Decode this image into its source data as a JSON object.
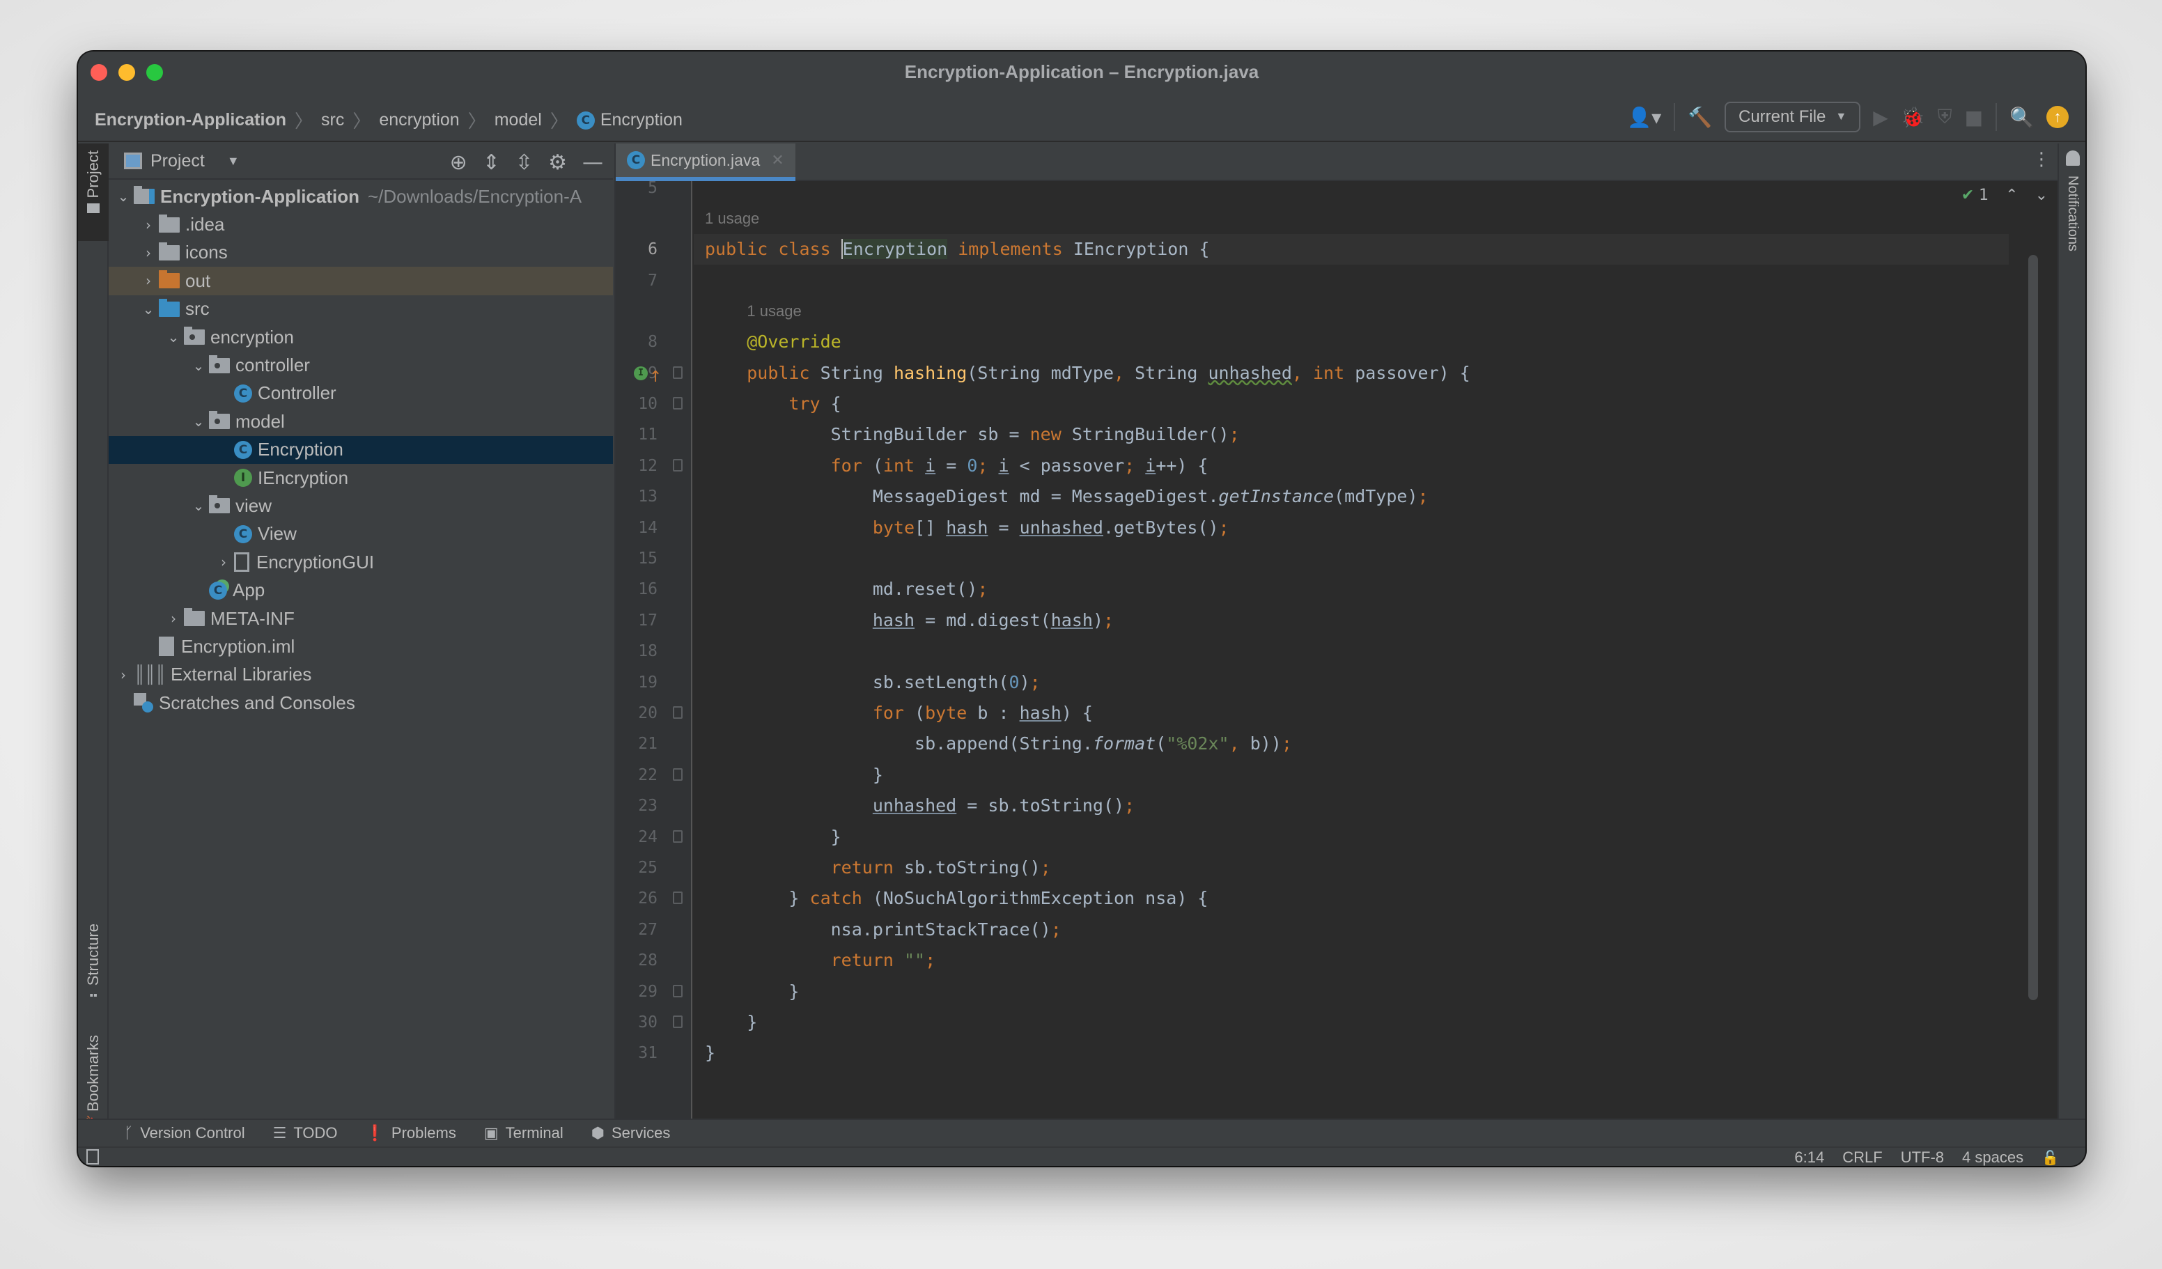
{
  "window": {
    "title": "Encryption-Application – Encryption.java"
  },
  "breadcrumb": [
    {
      "label": "Encryption-Application",
      "bold": true
    },
    {
      "label": "src"
    },
    {
      "label": "encryption"
    },
    {
      "label": "model"
    },
    {
      "label": "Encryption",
      "icon": "class-icon"
    }
  ],
  "toolbar": {
    "run_config": "Current File",
    "icons": [
      "vcs-user-icon",
      "build-hammer-icon",
      "run-icon",
      "debug-icon",
      "coverage-icon",
      "stop-icon",
      "search-icon",
      "update-icon"
    ]
  },
  "left_stripe": {
    "project": "Project",
    "structure": "Structure",
    "bookmarks": "Bookmarks"
  },
  "project_panel": {
    "title": "Project",
    "tree": [
      {
        "label": "Encryption-Application",
        "path": "~/Downloads/Encryption-A",
        "depth": 0,
        "arrow": "down",
        "icon": "module",
        "bold": true
      },
      {
        "label": ".idea",
        "depth": 1,
        "arrow": "right",
        "icon": "folder"
      },
      {
        "label": "icons",
        "depth": 1,
        "arrow": "right",
        "icon": "folder"
      },
      {
        "label": "out",
        "depth": 1,
        "arrow": "right",
        "icon": "folder-orange",
        "excluded": true
      },
      {
        "label": "src",
        "depth": 1,
        "arrow": "down",
        "icon": "folder-blue"
      },
      {
        "label": "encryption",
        "depth": 2,
        "arrow": "down",
        "icon": "package"
      },
      {
        "label": "controller",
        "depth": 3,
        "arrow": "down",
        "icon": "package"
      },
      {
        "label": "Controller",
        "depth": 4,
        "icon": "class"
      },
      {
        "label": "model",
        "depth": 3,
        "arrow": "down",
        "icon": "package"
      },
      {
        "label": "Encryption",
        "depth": 4,
        "icon": "class",
        "selected": true
      },
      {
        "label": "IEncryption",
        "depth": 4,
        "icon": "interface"
      },
      {
        "label": "view",
        "depth": 3,
        "arrow": "down",
        "icon": "package"
      },
      {
        "label": "View",
        "depth": 4,
        "icon": "class"
      },
      {
        "label": "EncryptionGUI",
        "depth": 4,
        "arrow": "right",
        "icon": "form",
        "arrowInline": true
      },
      {
        "label": "App",
        "depth": 3,
        "icon": "class-main"
      },
      {
        "label": "META-INF",
        "depth": 2,
        "arrow": "right",
        "icon": "folder"
      },
      {
        "label": "Encryption.iml",
        "depth": 1,
        "icon": "file"
      },
      {
        "label": "External Libraries",
        "depth": 0,
        "arrow": "right",
        "icon": "library"
      },
      {
        "label": "Scratches and Consoles",
        "depth": 0,
        "icon": "scratch"
      }
    ]
  },
  "editor": {
    "tab": "Encryption.java",
    "inspection_count": "1",
    "lines": [
      {
        "n": "5",
        "html": ""
      },
      {
        "n": "6",
        "hint": "1 usage",
        "html": "<span class=\"kw\">public class </span><span class=\"caret-sel\">Encryption</span> <span class=\"kw\">implements </span>IEncryption {",
        "current": true
      },
      {
        "n": "7",
        "html": ""
      },
      {
        "n": "8",
        "hint": "1 usage",
        "html": "    <span class=\"ann\">@Override</span>"
      },
      {
        "n": "9",
        "html": "    <span class=\"kw\">public </span>String <span class=\"fn\">hashing</span>(String mdType<span class=\"kw\">, </span>String <span class=\"warn\">unhashed</span><span class=\"kw\">, int </span>passover) {",
        "gutter": "implements"
      },
      {
        "n": "10",
        "html": "        <span class=\"kw\">try </span>{",
        "fold": true
      },
      {
        "n": "11",
        "html": "            StringBuilder sb = <span class=\"kw\">new </span>StringBuilder()<span class=\"kw\">;</span>"
      },
      {
        "n": "12",
        "html": "            <span class=\"kw\">for </span>(<span class=\"kw\">int </span><span class=\"ul\">i</span> = <span class=\"num\">0</span><span class=\"kw\">; </span><span class=\"ul\">i</span> &lt; passover<span class=\"kw\">; </span><span class=\"ul\">i</span>++) {",
        "fold": true
      },
      {
        "n": "13",
        "html": "                MessageDigest md = MessageDigest.<span class=\"it\">getInstance</span>(mdType)<span class=\"kw\">;</span>"
      },
      {
        "n": "14",
        "html": "                <span class=\"kw\">byte</span>[] <span class=\"ul\">hash</span> = <span class=\"ul\">unhashed</span>.getBytes()<span class=\"kw\">;</span>"
      },
      {
        "n": "15",
        "html": ""
      },
      {
        "n": "16",
        "html": "                md.reset()<span class=\"kw\">;</span>"
      },
      {
        "n": "17",
        "html": "                <span class=\"ul\">hash</span> = md.digest(<span class=\"ul\">hash</span>)<span class=\"kw\">;</span>"
      },
      {
        "n": "18",
        "html": ""
      },
      {
        "n": "19",
        "html": "                sb.setLength(<span class=\"num\">0</span>)<span class=\"kw\">;</span>"
      },
      {
        "n": "20",
        "html": "                <span class=\"kw\">for </span>(<span class=\"kw\">byte </span>b : <span class=\"ul\">hash</span>) {",
        "fold": true
      },
      {
        "n": "21",
        "html": "                    sb.append(String.<span class=\"it\">format</span>(<span class=\"str\">\"%02x\"</span><span class=\"kw\">, </span>b))<span class=\"kw\">;</span>"
      },
      {
        "n": "22",
        "html": "                }",
        "fold": true
      },
      {
        "n": "23",
        "html": "                <span class=\"ul\">unhashed</span> = sb.toString()<span class=\"kw\">;</span>"
      },
      {
        "n": "24",
        "html": "            }",
        "fold": true
      },
      {
        "n": "25",
        "html": "            <span class=\"kw\">return </span>sb.toString()<span class=\"kw\">;</span>"
      },
      {
        "n": "26",
        "html": "        } <span class=\"kw\">catch </span>(NoSuchAlgorithmException nsa) {",
        "fold": true
      },
      {
        "n": "27",
        "html": "            nsa.printStackTrace()<span class=\"kw\">;</span>"
      },
      {
        "n": "28",
        "html": "            <span class=\"kw\">return </span><span class=\"str\">\"\"</span><span class=\"kw\">;</span>"
      },
      {
        "n": "29",
        "html": "        }",
        "fold": true
      },
      {
        "n": "30",
        "html": "    }",
        "fold": true
      },
      {
        "n": "31",
        "html": "}"
      }
    ]
  },
  "right_stripe": {
    "notifications": "Notifications"
  },
  "bottom_tools": [
    {
      "label": "Version Control",
      "icon": "vcs-branch-icon",
      "glyph": "ᚴ"
    },
    {
      "label": "TODO",
      "icon": "todo-list-icon",
      "glyph": "☰"
    },
    {
      "label": "Problems",
      "icon": "problems-icon",
      "glyph": "❗"
    },
    {
      "label": "Terminal",
      "icon": "terminal-icon",
      "glyph": "▣"
    },
    {
      "label": "Services",
      "icon": "services-icon",
      "glyph": "⬢"
    }
  ],
  "status": {
    "position": "6:14",
    "line_separator": "CRLF",
    "encoding": "UTF-8",
    "indent": "4 spaces"
  }
}
